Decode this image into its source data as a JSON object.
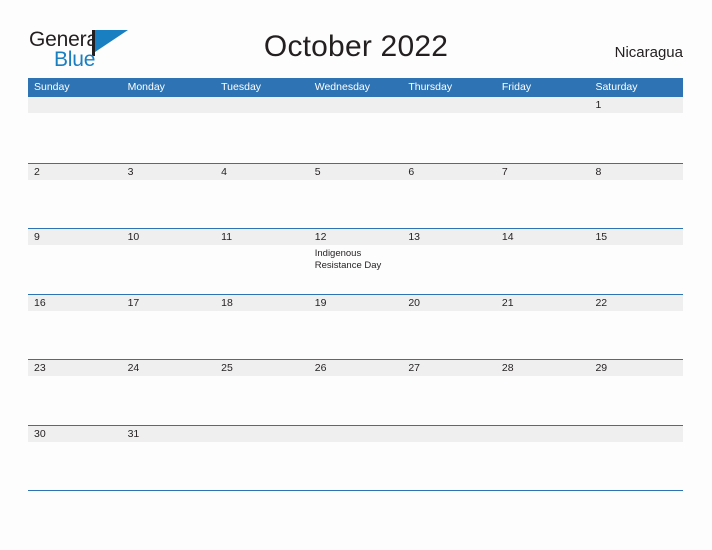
{
  "brand": {
    "name_part1": "General",
    "name_part2": "Blue",
    "flag_icon": "flag-triangle-icon",
    "colors": {
      "dark": "#231f20",
      "blue": "#1a7fc1",
      "header_blue": "#2e74b5",
      "band_gray": "#efefef"
    }
  },
  "header": {
    "title": "October 2022",
    "country": "Nicaragua"
  },
  "calendar": {
    "weekdays": [
      "Sunday",
      "Monday",
      "Tuesday",
      "Wednesday",
      "Thursday",
      "Friday",
      "Saturday"
    ],
    "weeks": [
      [
        {
          "day": ""
        },
        {
          "day": ""
        },
        {
          "day": ""
        },
        {
          "day": ""
        },
        {
          "day": ""
        },
        {
          "day": ""
        },
        {
          "day": "1"
        }
      ],
      [
        {
          "day": "2"
        },
        {
          "day": "3"
        },
        {
          "day": "4"
        },
        {
          "day": "5"
        },
        {
          "day": "6"
        },
        {
          "day": "7"
        },
        {
          "day": "8"
        }
      ],
      [
        {
          "day": "9"
        },
        {
          "day": "10"
        },
        {
          "day": "11"
        },
        {
          "day": "12",
          "event": "Indigenous Resistance Day"
        },
        {
          "day": "13"
        },
        {
          "day": "14"
        },
        {
          "day": "15"
        }
      ],
      [
        {
          "day": "16"
        },
        {
          "day": "17"
        },
        {
          "day": "18"
        },
        {
          "day": "19"
        },
        {
          "day": "20"
        },
        {
          "day": "21"
        },
        {
          "day": "22"
        }
      ],
      [
        {
          "day": "23"
        },
        {
          "day": "24"
        },
        {
          "day": "25"
        },
        {
          "day": "26"
        },
        {
          "day": "27"
        },
        {
          "day": "28"
        },
        {
          "day": "29"
        }
      ],
      [
        {
          "day": "30"
        },
        {
          "day": "31"
        },
        {
          "day": ""
        },
        {
          "day": ""
        },
        {
          "day": ""
        },
        {
          "day": ""
        },
        {
          "day": ""
        }
      ]
    ]
  }
}
